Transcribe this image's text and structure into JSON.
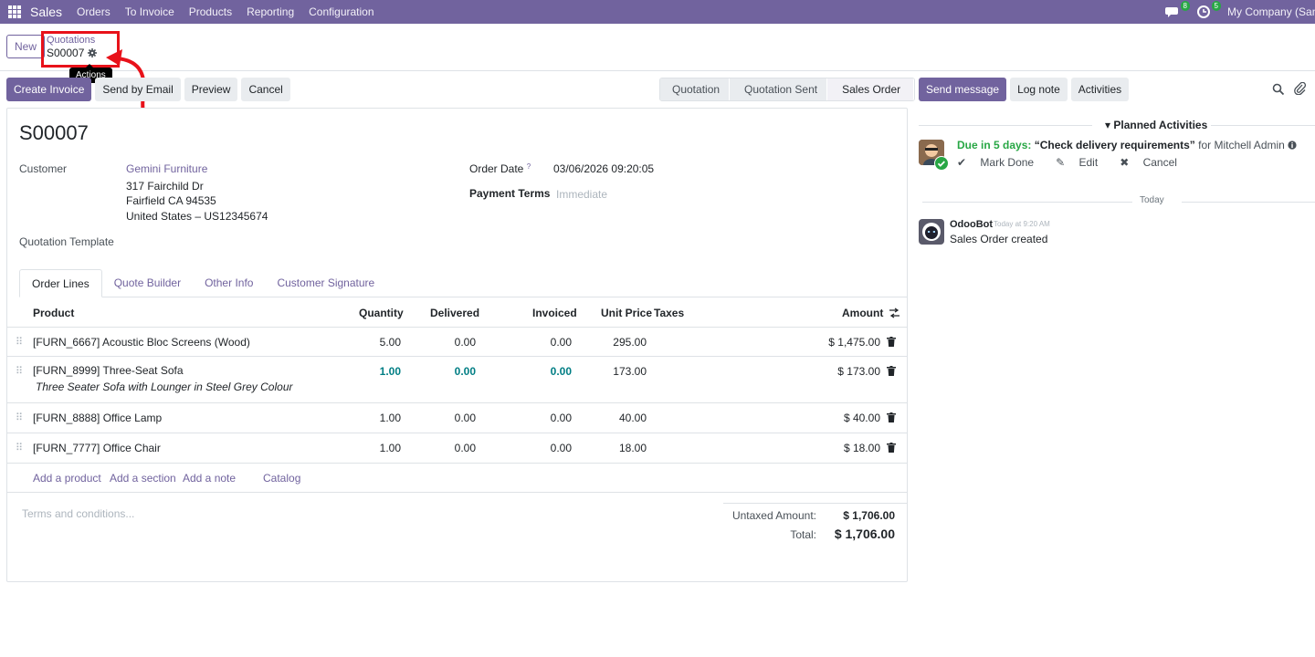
{
  "navbar": {
    "app_name": "Sales",
    "menu": [
      "Orders",
      "To Invoice",
      "Products",
      "Reporting",
      "Configuration"
    ],
    "messages_badge": "8",
    "activities_badge": "5",
    "company": "My Company (San F"
  },
  "control_panel": {
    "new_label": "New",
    "breadcrumb_parent": "Quotations",
    "breadcrumb_current": "S00007",
    "tooltip": "Actions"
  },
  "actions": {
    "create_invoice": "Create Invoice",
    "send_email": "Send by Email",
    "preview": "Preview",
    "cancel": "Cancel"
  },
  "statusbar": {
    "stages": [
      "Quotation",
      "Quotation Sent",
      "Sales Order"
    ],
    "active": "Sales Order"
  },
  "form": {
    "title": "S00007",
    "customer_label": "Customer",
    "customer_name": "Gemini Furniture",
    "address_line1": "317 Fairchild Dr",
    "address_line2": "Fairfield CA 94535",
    "address_line3": "United States – US12345674",
    "order_date_label": "Order Date",
    "order_date_help": "?",
    "order_date": "03/06/2026 09:20:05",
    "payment_terms_label": "Payment Terms",
    "payment_terms_placeholder": "Immediate",
    "template_label": "Quotation Template"
  },
  "tabs": [
    "Order Lines",
    "Quote Builder",
    "Other Info",
    "Customer Signature"
  ],
  "table": {
    "headers": {
      "product": "Product",
      "quantity": "Quantity",
      "delivered": "Delivered",
      "invoiced": "Invoiced",
      "unit_price": "Unit Price",
      "taxes": "Taxes",
      "amount": "Amount"
    },
    "rows": [
      {
        "product": "[FURN_6667] Acoustic Bloc Screens (Wood)",
        "description": "",
        "quantity": "5.00",
        "delivered": "0.00",
        "invoiced": "0.00",
        "unit_price": "295.00",
        "amount": "$ 1,475.00"
      },
      {
        "product": "[FURN_8999] Three-Seat Sofa",
        "description": "Three Seater Sofa with Lounger in Steel Grey Colour",
        "quantity": "1.00",
        "delivered": "0.00",
        "invoiced": "0.00",
        "unit_price": "173.00",
        "amount": "$ 173.00"
      },
      {
        "product": "[FURN_8888] Office Lamp",
        "description": "",
        "quantity": "1.00",
        "delivered": "0.00",
        "invoiced": "0.00",
        "unit_price": "40.00",
        "amount": "$ 40.00"
      },
      {
        "product": "[FURN_7777] Office Chair",
        "description": "",
        "quantity": "1.00",
        "delivered": "0.00",
        "invoiced": "0.00",
        "unit_price": "18.00",
        "amount": "$ 18.00"
      }
    ],
    "add_links": [
      "Add a product",
      "Add a section",
      "Add a note",
      "Catalog"
    ]
  },
  "terms_placeholder": "Terms and conditions...",
  "totals": {
    "untaxed_label": "Untaxed Amount:",
    "untaxed_value": "$ 1,706.00",
    "total_label": "Total:",
    "total_value": "$ 1,706.00"
  },
  "chatter": {
    "send_message": "Send message",
    "log_note": "Log note",
    "activities": "Activities",
    "planned_title": "Planned Activities",
    "due_text": "Due in 5 days:",
    "activity_title": "“Check delivery requirements”",
    "activity_for": "for Mitchell Admin",
    "mark_done": "Mark Done",
    "edit": "Edit",
    "cancel": "Cancel",
    "today": "Today",
    "author": "OdooBot",
    "time": "Today at 9:20 AM",
    "message": "Sales Order created"
  },
  "colors": {
    "brand": "#71639e",
    "annotation": "#e8121a",
    "success": "#28a745"
  }
}
